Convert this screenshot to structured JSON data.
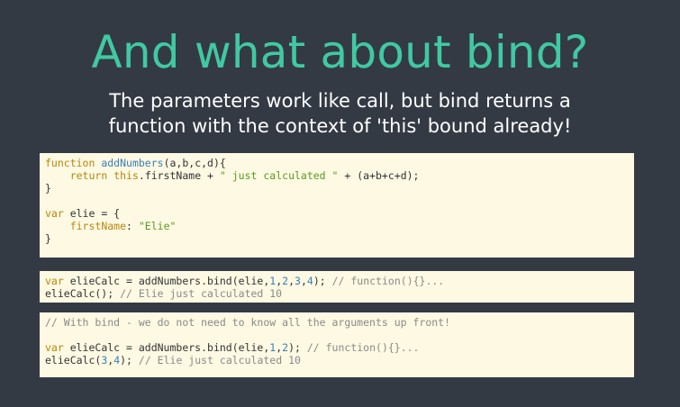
{
  "slide": {
    "title": "And what about bind?",
    "subtitle_line1": "The parameters work like call, but bind returns a",
    "subtitle_line2": "function with the context of 'this' bound already!"
  },
  "code_block_1": {
    "l1_kw": "function",
    "l1_fn": "addNumbers",
    "l1_rest": "(a,b,c,d){",
    "l2_indent": "    ",
    "l2_kw_return": "return",
    "l2_sp": " ",
    "l2_kw_this": "this",
    "l2_mid": ".firstName + ",
    "l2_str": "\" just calculated \"",
    "l2_end": " + (a+b+c+d);",
    "l3": "}",
    "l5_kw": "var",
    "l5_rest": " elie = {",
    "l6_indent": "    ",
    "l6_prop": "firstName",
    "l6_colon": ": ",
    "l6_str": "\"Elie\"",
    "l7": "}"
  },
  "code_block_2": {
    "l1_kw": "var",
    "l1_a": " elieCalc = addNumbers.bind(elie,",
    "l1_n1": "1",
    "l1_c1": ",",
    "l1_n2": "2",
    "l1_c2": ",",
    "l1_n3": "3",
    "l1_c3": ",",
    "l1_n4": "4",
    "l1_b": "); ",
    "l1_cm": "// function(){}...",
    "l2_a": "elieCalc(); ",
    "l2_cm": "// Elie just calculated 10"
  },
  "code_block_3": {
    "l1_cm": "// With bind - we do not need to know all the arguments up front!",
    "l3_kw": "var",
    "l3_a": " elieCalc = addNumbers.bind(elie,",
    "l3_n1": "1",
    "l3_c1": ",",
    "l3_n2": "2",
    "l3_b": "); ",
    "l3_cm": "// function(){}...",
    "l4_a": "elieCalc(",
    "l4_n1": "3",
    "l4_c1": ",",
    "l4_n2": "4",
    "l4_b": "); ",
    "l4_cm": "// Elie just calculated 10"
  }
}
